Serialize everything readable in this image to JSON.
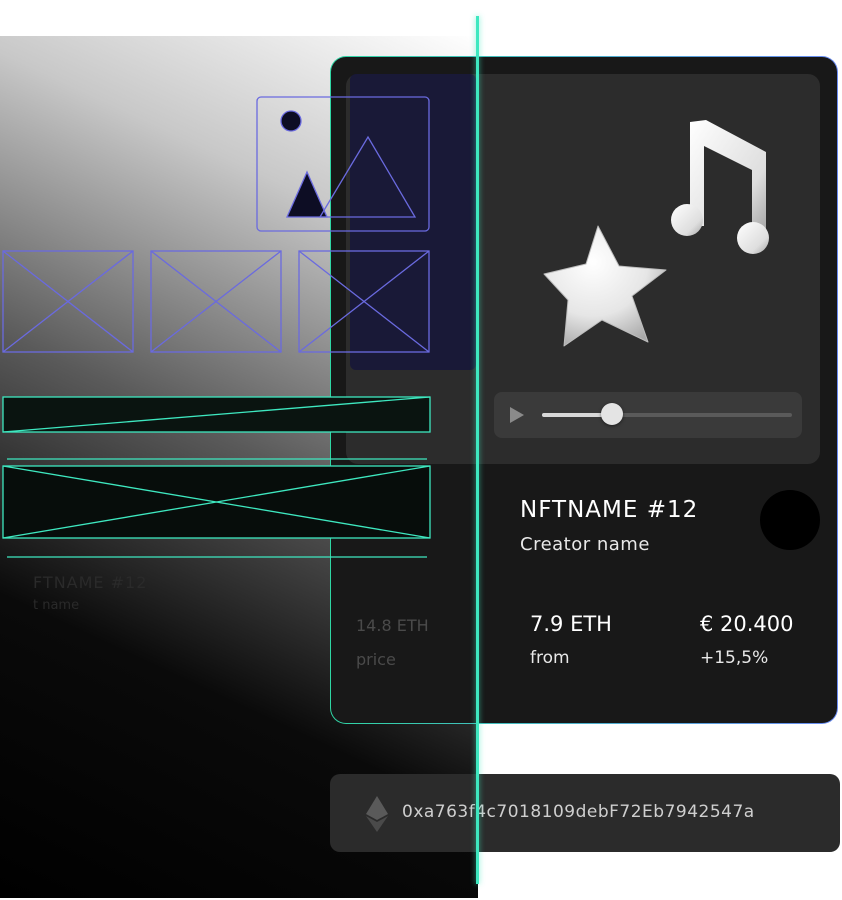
{
  "nft": {
    "name": "NFTNAME #12",
    "creator": "Creator name",
    "price_eth": "7.9 ETH",
    "price_label": "from",
    "price_eur": "€ 20.400",
    "change": "+15,5%"
  },
  "ghost": {
    "name": "FTNAME #12",
    "creator": "t name",
    "price_eth": "14.8 ETH",
    "price_label": "price"
  },
  "player": {
    "progress": 0.28
  },
  "wallet": {
    "address": "0xa763f4c7018109debF72Eb7942547a",
    "icon": "ethereum-icon"
  },
  "icons": {
    "artwork": [
      "star-icon",
      "music-note-icon"
    ],
    "play": "play-icon"
  },
  "colors": {
    "accent_green": "#3ee8c0",
    "accent_blue": "#6a6adf",
    "card_bg": "#181818",
    "media_bg": "#2c2c2c"
  }
}
